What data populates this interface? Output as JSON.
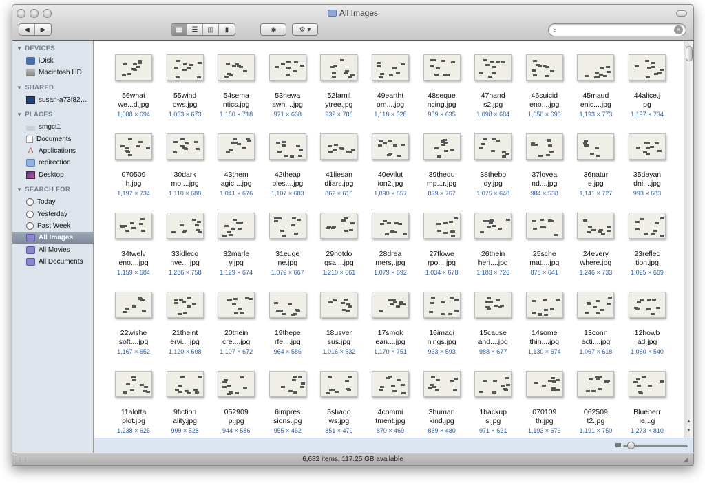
{
  "window": {
    "title": "All Images"
  },
  "toolbar": {
    "back_icon": "back-arrow-icon",
    "forward_icon": "forward-arrow-icon",
    "view_modes": [
      "icon-view",
      "list-view",
      "column-view",
      "coverflow-view"
    ],
    "active_view": "icon-view",
    "quicklook_icon": "eye-icon",
    "action_icon": "gear-icon",
    "search": {
      "value": "",
      "placeholder": ""
    }
  },
  "sidebar": {
    "sections": [
      {
        "title": "DEVICES",
        "items": [
          {
            "label": "iDisk",
            "icon": "idisk-icon"
          },
          {
            "label": "Macintosh HD",
            "icon": "hard-drive-icon"
          }
        ]
      },
      {
        "title": "SHARED",
        "items": [
          {
            "label": "susan-a73f82…",
            "icon": "shared-computer-icon"
          }
        ]
      },
      {
        "title": "PLACES",
        "items": [
          {
            "label": "smgct1",
            "icon": "home-icon"
          },
          {
            "label": "Documents",
            "icon": "documents-icon"
          },
          {
            "label": "Applications",
            "icon": "applications-icon"
          },
          {
            "label": "redirection",
            "icon": "folder-icon"
          },
          {
            "label": "Desktop",
            "icon": "desktop-icon"
          }
        ]
      },
      {
        "title": "SEARCH FOR",
        "items": [
          {
            "label": "Today",
            "icon": "clock-icon"
          },
          {
            "label": "Yesterday",
            "icon": "clock-icon"
          },
          {
            "label": "Past Week",
            "icon": "clock-icon"
          },
          {
            "label": "All Images",
            "icon": "smart-folder-icon",
            "selected": true
          },
          {
            "label": "All Movies",
            "icon": "smart-folder-icon"
          },
          {
            "label": "All Documents",
            "icon": "smart-folder-icon"
          }
        ]
      }
    ]
  },
  "files": [
    [
      {
        "name": "56what\nwe...d.jpg",
        "dims": "1,088 × 694"
      },
      {
        "name": "55wind\nows.jpg",
        "dims": "1,053 × 673"
      },
      {
        "name": "54sema\nntics.jpg",
        "dims": "1,180 × 718"
      },
      {
        "name": "53hewa\nswh....jpg",
        "dims": "971 × 668"
      },
      {
        "name": "52famil\nytree.jpg",
        "dims": "932 × 786"
      },
      {
        "name": "49eartht\nom....jpg",
        "dims": "1,118 × 628"
      },
      {
        "name": "48seque\nncing.jpg",
        "dims": "959 × 635"
      },
      {
        "name": "47hand\ns2.jpg",
        "dims": "1,098 × 684"
      },
      {
        "name": "46suicid\neno....jpg",
        "dims": "1,050 × 696"
      },
      {
        "name": "45maud\nenic....jpg",
        "dims": "1,193 × 773"
      },
      {
        "name": "44alice.j\npg",
        "dims": "1,197 × 734"
      }
    ],
    [
      {
        "name": "070509\nh.jpg",
        "dims": "1,197 × 734"
      },
      {
        "name": "30dark\nmo....jpg",
        "dims": "1,110 × 688"
      },
      {
        "name": "43them\nagic....jpg",
        "dims": "1,041 × 676"
      },
      {
        "name": "42theap\nples....jpg",
        "dims": "1,107 × 683"
      },
      {
        "name": "41liesan\ndliars.jpg",
        "dims": "862 × 616"
      },
      {
        "name": "40evilut\nion2.jpg",
        "dims": "1,090 × 657"
      },
      {
        "name": "39thedu\nmp...r.jpg",
        "dims": "899 × 767"
      },
      {
        "name": "38thebo\ndy.jpg",
        "dims": "1,075 × 648"
      },
      {
        "name": "37lovea\nnd....jpg",
        "dims": "984 × 538"
      },
      {
        "name": "36natur\ne.jpg",
        "dims": "1,141 × 727"
      },
      {
        "name": "35dayan\ndni....jpg",
        "dims": "993 × 683"
      }
    ],
    [
      {
        "name": "34twelv\neno....jpg",
        "dims": "1,159 × 684"
      },
      {
        "name": "33idleco\nnve....jpg",
        "dims": "1,286 × 758"
      },
      {
        "name": "32marle\ny.jpg",
        "dims": "1,129 × 674"
      },
      {
        "name": "31euge\nne.jpg",
        "dims": "1,072 × 667"
      },
      {
        "name": "29hotdo\ngsa....jpg",
        "dims": "1,210 × 661"
      },
      {
        "name": "28drea\nmers,.jpg",
        "dims": "1,079 × 692"
      },
      {
        "name": "27flowe\nrpo....jpg",
        "dims": "1,034 × 678"
      },
      {
        "name": "26thein\nheri....jpg",
        "dims": "1,183 × 726"
      },
      {
        "name": "25sche\nmat....jpg",
        "dims": "878 × 641"
      },
      {
        "name": "24every\nwhere.jpg",
        "dims": "1,246 × 733"
      },
      {
        "name": "23reflec\ntion.jpg",
        "dims": "1,025 × 669"
      }
    ],
    [
      {
        "name": "22wishe\nsoft....jpg",
        "dims": "1,167 × 652"
      },
      {
        "name": "21theint\nervi....jpg",
        "dims": "1,120 × 608"
      },
      {
        "name": "20thein\ncre....jpg",
        "dims": "1,107 × 672"
      },
      {
        "name": "19thepe\nrfe....jpg",
        "dims": "964 × 586"
      },
      {
        "name": "18usver\nsus.jpg",
        "dims": "1,016 × 632"
      },
      {
        "name": "17smok\nean....jpg",
        "dims": "1,170 × 751"
      },
      {
        "name": "16imagi\nnings.jpg",
        "dims": "933 × 593"
      },
      {
        "name": "15cause\nand....jpg",
        "dims": "988 × 677"
      },
      {
        "name": "14some\nthin....jpg",
        "dims": "1,130 × 674"
      },
      {
        "name": "13conn\necti....jpg",
        "dims": "1,067 × 618"
      },
      {
        "name": "12howb\nad.jpg",
        "dims": "1,060 × 540"
      }
    ],
    [
      {
        "name": "11alotta\nplot.jpg",
        "dims": "1,238 × 626"
      },
      {
        "name": "9fiction\nality.jpg",
        "dims": "999 × 528"
      },
      {
        "name": "052909\np.jpg",
        "dims": "944 × 586"
      },
      {
        "name": "6impres\nsions.jpg",
        "dims": "955 × 462"
      },
      {
        "name": "5shado\nws.jpg",
        "dims": "851 × 479"
      },
      {
        "name": "4commi\ntment.jpg",
        "dims": "870 × 469"
      },
      {
        "name": "3human\nkind.jpg",
        "dims": "889 × 480"
      },
      {
        "name": "1backup\ns.jpg",
        "dims": "971 × 621"
      },
      {
        "name": "070109\nth.jpg",
        "dims": "1,193 × 673"
      },
      {
        "name": "062509\nt2.jpg",
        "dims": "1,191 × 750"
      },
      {
        "name": "Blueberr\nie...g",
        "dims": "1,273 × 810"
      }
    ]
  ],
  "accent_colors": {
    "selection": "#7d899a",
    "dims_text": "#2f5fa0",
    "zoom_bar": "#dce6f3"
  },
  "status": {
    "text": "6,682 items, 117.25 GB available"
  }
}
